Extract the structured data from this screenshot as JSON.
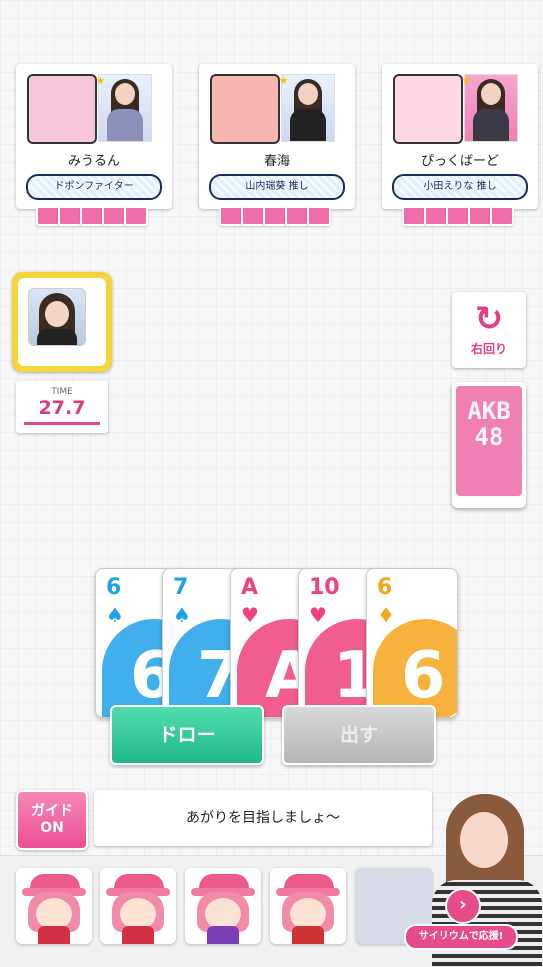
{
  "players": [
    {
      "name": "みうるん",
      "tag": "ドボンファイター"
    },
    {
      "name": "春海",
      "tag": "山内瑞葵 推し"
    },
    {
      "name": "ぴっくばーど",
      "tag": "小田えりな 推し"
    }
  ],
  "timer": {
    "label": "TIME",
    "value": "27.7"
  },
  "rotation": {
    "label": "右回り",
    "icon": "rotate-right-icon"
  },
  "deck": {
    "logo_line1": "AKB",
    "logo_line2": "48"
  },
  "hand": [
    {
      "rank": "6",
      "suit": "♠",
      "color": "#1fa1e8"
    },
    {
      "rank": "7",
      "suit": "♠",
      "color": "#1fa1e8"
    },
    {
      "rank": "A",
      "suit": "♥",
      "color": "#f0417c"
    },
    {
      "rank": "10",
      "suit": "♥",
      "color": "#f0417c"
    },
    {
      "rank": "6",
      "suit": "♦",
      "color": "#f5a51a"
    }
  ],
  "actions": {
    "draw": "ドロー",
    "play": "出す"
  },
  "guide": {
    "line1": "ガイド",
    "line2": "ON"
  },
  "message": "あがりを目指しましょ〜",
  "promo": {
    "label": "サイリウムで応援!"
  }
}
